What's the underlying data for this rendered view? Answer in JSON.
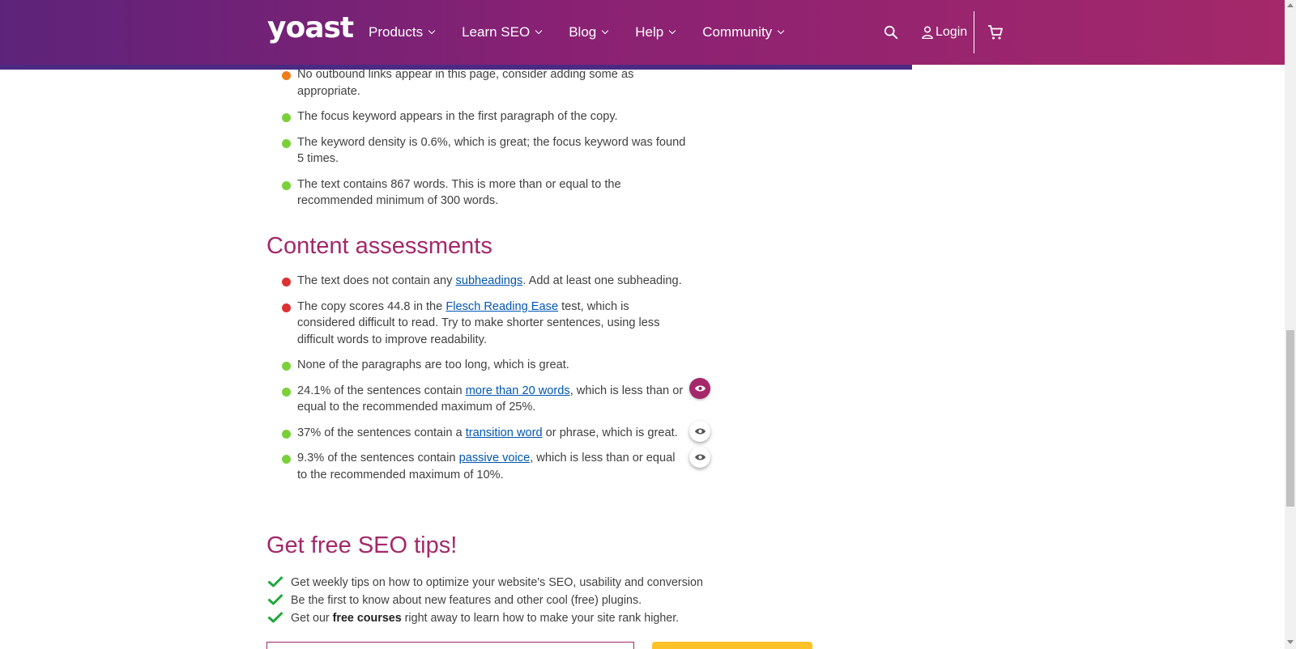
{
  "header": {
    "logo": "yoast",
    "nav": [
      {
        "label": "Products"
      },
      {
        "label": "Learn SEO"
      },
      {
        "label": "Blog"
      },
      {
        "label": "Help"
      },
      {
        "label": "Community"
      }
    ],
    "login_label": "Login",
    "search_icon": "search-icon",
    "cart_icon": "cart-icon"
  },
  "colors": {
    "brand": "#a4286a",
    "header_start": "#5d237a",
    "good": "#7ad03a",
    "ok": "#ee7c1b",
    "bad": "#dc3232",
    "cta": "#fec228"
  },
  "seo_list": [
    {
      "status": "ok",
      "text": "No outbound links appear in this page, consider adding some as appropriate."
    },
    {
      "status": "good",
      "text": "The focus keyword appears in the first paragraph of the copy."
    },
    {
      "status": "good",
      "text": "The keyword density is 0.6%, which is great; the focus keyword was found 5 times."
    },
    {
      "status": "good",
      "text": "The text contains 867 words. This is more than or equal to the recommended minimum of 300 words."
    }
  ],
  "content_section": {
    "title": "Content assessments",
    "items": [
      {
        "status": "bad",
        "before": "The text does not contain any ",
        "link": "subheadings",
        "after": ". Add at least one subheading."
      },
      {
        "status": "bad",
        "before": "The copy scores 44.8 in the ",
        "link": "Flesch Reading Ease",
        "after": " test, which is considered difficult to read. Try to make shorter sentences, using less difficult words to improve readability."
      },
      {
        "status": "good",
        "before": "None of the paragraphs are too long, which is great.",
        "link": "",
        "after": ""
      },
      {
        "status": "good",
        "before": "24.1% of the sentences contain ",
        "link": "more than 20 words",
        "after": ", which is less than or equal to the recommended maximum of 25%."
      },
      {
        "status": "good",
        "before": "37% of the sentences contain a ",
        "link": "transition word",
        "after": " or phrase, which is great."
      },
      {
        "status": "good",
        "before": "9.3% of the sentences contain ",
        "link": "passive voice",
        "after": ", which is less than or equal to the recommended maximum of 10%."
      }
    ]
  },
  "tips_section": {
    "title": "Get free SEO tips!",
    "items": [
      {
        "before": "Get weekly tips on how to optimize your website's SEO, usability and conversion",
        "bold": "",
        "after": ""
      },
      {
        "before": "Be the first to know about new features and other cool (free) plugins.",
        "bold": "",
        "after": ""
      },
      {
        "before": "Get our ",
        "bold": "free courses",
        "after": " right away to learn how to make your site rank higher."
      }
    ]
  }
}
